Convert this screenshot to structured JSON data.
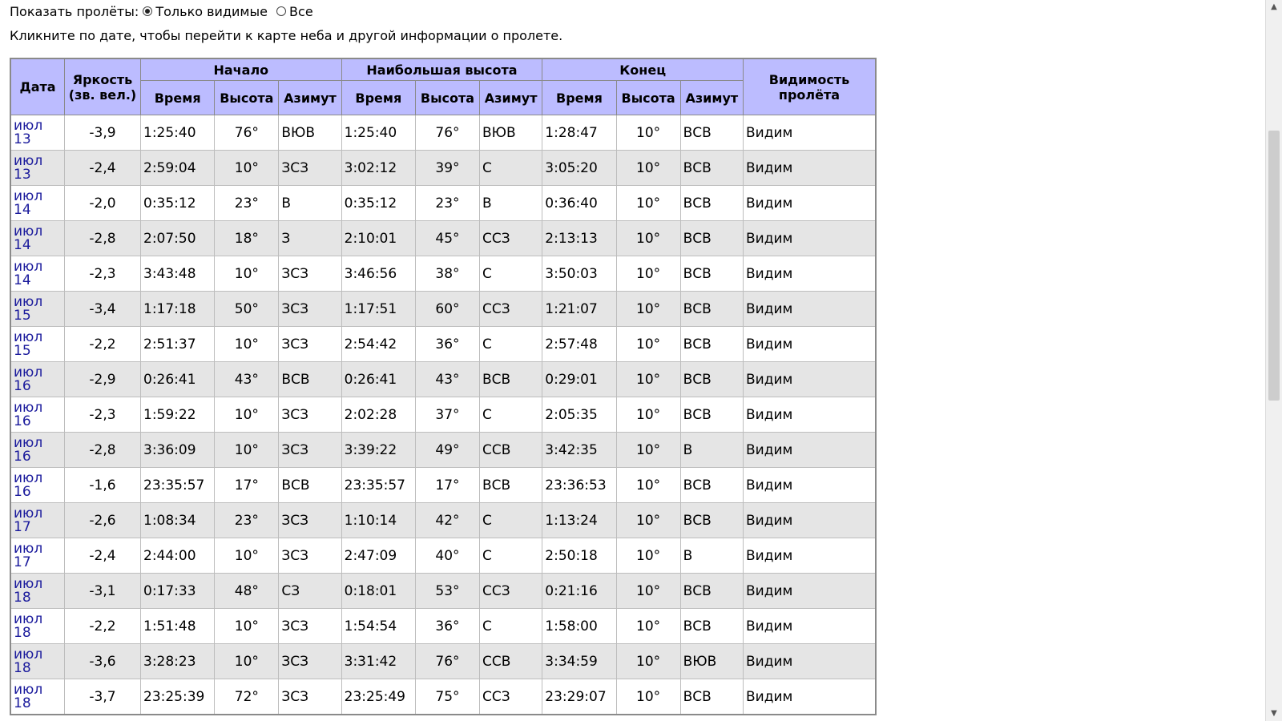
{
  "filter": {
    "label": "Показать пролёты:",
    "option_visible": "Только видимые",
    "option_all": "Все",
    "selected": "Только видимые"
  },
  "hint": "Кликните по дате, чтобы перейти к карте неба и другой информации о пролете.",
  "table": {
    "headers": {
      "date": "Дата",
      "brightness": "Яркость (зв. вел.)",
      "start": "Начало",
      "max": "Наибольшая высота",
      "end": "Конец",
      "visibility": "Видимость пролёта",
      "time": "Время",
      "altitude": "Высота",
      "azimuth": "Азимут"
    },
    "rows": [
      {
        "month": "июл",
        "day": "13",
        "mag": "-3,9",
        "s_time": "1:25:40",
        "s_alt": "76°",
        "s_az": "ВЮВ",
        "m_time": "1:25:40",
        "m_alt": "76°",
        "m_az": "ВЮВ",
        "e_time": "1:28:47",
        "e_alt": "10°",
        "e_az": "ВСВ",
        "vis": "Видим"
      },
      {
        "month": "июл",
        "day": "13",
        "mag": "-2,4",
        "s_time": "2:59:04",
        "s_alt": "10°",
        "s_az": "ЗСЗ",
        "m_time": "3:02:12",
        "m_alt": "39°",
        "m_az": "С",
        "e_time": "3:05:20",
        "e_alt": "10°",
        "e_az": "ВСВ",
        "vis": "Видим"
      },
      {
        "month": "июл",
        "day": "14",
        "mag": "-2,0",
        "s_time": "0:35:12",
        "s_alt": "23°",
        "s_az": "В",
        "m_time": "0:35:12",
        "m_alt": "23°",
        "m_az": "В",
        "e_time": "0:36:40",
        "e_alt": "10°",
        "e_az": "ВСВ",
        "vis": "Видим"
      },
      {
        "month": "июл",
        "day": "14",
        "mag": "-2,8",
        "s_time": "2:07:50",
        "s_alt": "18°",
        "s_az": "З",
        "m_time": "2:10:01",
        "m_alt": "45°",
        "m_az": "ССЗ",
        "e_time": "2:13:13",
        "e_alt": "10°",
        "e_az": "ВСВ",
        "vis": "Видим"
      },
      {
        "month": "июл",
        "day": "14",
        "mag": "-2,3",
        "s_time": "3:43:48",
        "s_alt": "10°",
        "s_az": "ЗСЗ",
        "m_time": "3:46:56",
        "m_alt": "38°",
        "m_az": "С",
        "e_time": "3:50:03",
        "e_alt": "10°",
        "e_az": "ВСВ",
        "vis": "Видим"
      },
      {
        "month": "июл",
        "day": "15",
        "mag": "-3,4",
        "s_time": "1:17:18",
        "s_alt": "50°",
        "s_az": "ЗСЗ",
        "m_time": "1:17:51",
        "m_alt": "60°",
        "m_az": "ССЗ",
        "e_time": "1:21:07",
        "e_alt": "10°",
        "e_az": "ВСВ",
        "vis": "Видим"
      },
      {
        "month": "июл",
        "day": "15",
        "mag": "-2,2",
        "s_time": "2:51:37",
        "s_alt": "10°",
        "s_az": "ЗСЗ",
        "m_time": "2:54:42",
        "m_alt": "36°",
        "m_az": "С",
        "e_time": "2:57:48",
        "e_alt": "10°",
        "e_az": "ВСВ",
        "vis": "Видим"
      },
      {
        "month": "июл",
        "day": "16",
        "mag": "-2,9",
        "s_time": "0:26:41",
        "s_alt": "43°",
        "s_az": "ВСВ",
        "m_time": "0:26:41",
        "m_alt": "43°",
        "m_az": "ВСВ",
        "e_time": "0:29:01",
        "e_alt": "10°",
        "e_az": "ВСВ",
        "vis": "Видим"
      },
      {
        "month": "июл",
        "day": "16",
        "mag": "-2,3",
        "s_time": "1:59:22",
        "s_alt": "10°",
        "s_az": "ЗСЗ",
        "m_time": "2:02:28",
        "m_alt": "37°",
        "m_az": "С",
        "e_time": "2:05:35",
        "e_alt": "10°",
        "e_az": "ВСВ",
        "vis": "Видим"
      },
      {
        "month": "июл",
        "day": "16",
        "mag": "-2,8",
        "s_time": "3:36:09",
        "s_alt": "10°",
        "s_az": "ЗСЗ",
        "m_time": "3:39:22",
        "m_alt": "49°",
        "m_az": "ССВ",
        "e_time": "3:42:35",
        "e_alt": "10°",
        "e_az": "В",
        "vis": "Видим"
      },
      {
        "month": "июл",
        "day": "16",
        "mag": "-1,6",
        "s_time": "23:35:57",
        "s_alt": "17°",
        "s_az": "ВСВ",
        "m_time": "23:35:57",
        "m_alt": "17°",
        "m_az": "ВСВ",
        "e_time": "23:36:53",
        "e_alt": "10°",
        "e_az": "ВСВ",
        "vis": "Видим"
      },
      {
        "month": "июл",
        "day": "17",
        "mag": "-2,6",
        "s_time": "1:08:34",
        "s_alt": "23°",
        "s_az": "ЗСЗ",
        "m_time": "1:10:14",
        "m_alt": "42°",
        "m_az": "С",
        "e_time": "1:13:24",
        "e_alt": "10°",
        "e_az": "ВСВ",
        "vis": "Видим"
      },
      {
        "month": "июл",
        "day": "17",
        "mag": "-2,4",
        "s_time": "2:44:00",
        "s_alt": "10°",
        "s_az": "ЗСЗ",
        "m_time": "2:47:09",
        "m_alt": "40°",
        "m_az": "С",
        "e_time": "2:50:18",
        "e_alt": "10°",
        "e_az": "В",
        "vis": "Видим"
      },
      {
        "month": "июл",
        "day": "18",
        "mag": "-3,1",
        "s_time": "0:17:33",
        "s_alt": "48°",
        "s_az": "СЗ",
        "m_time": "0:18:01",
        "m_alt": "53°",
        "m_az": "ССЗ",
        "e_time": "0:21:16",
        "e_alt": "10°",
        "e_az": "ВСВ",
        "vis": "Видим"
      },
      {
        "month": "июл",
        "day": "18",
        "mag": "-2,2",
        "s_time": "1:51:48",
        "s_alt": "10°",
        "s_az": "ЗСЗ",
        "m_time": "1:54:54",
        "m_alt": "36°",
        "m_az": "С",
        "e_time": "1:58:00",
        "e_alt": "10°",
        "e_az": "ВСВ",
        "vis": "Видим"
      },
      {
        "month": "июл",
        "day": "18",
        "mag": "-3,6",
        "s_time": "3:28:23",
        "s_alt": "10°",
        "s_az": "ЗСЗ",
        "m_time": "3:31:42",
        "m_alt": "76°",
        "m_az": "ССВ",
        "e_time": "3:34:59",
        "e_alt": "10°",
        "e_az": "ВЮВ",
        "vis": "Видим"
      },
      {
        "month": "июл",
        "day": "18",
        "mag": "-3,7",
        "s_time": "23:25:39",
        "s_alt": "72°",
        "s_az": "ЗСЗ",
        "m_time": "23:25:49",
        "m_alt": "75°",
        "m_az": "ССЗ",
        "e_time": "23:29:07",
        "e_alt": "10°",
        "e_az": "ВСВ",
        "vis": "Видим"
      }
    ]
  },
  "scrollbar": {
    "up_icon": "▲",
    "down_icon": "▼"
  }
}
